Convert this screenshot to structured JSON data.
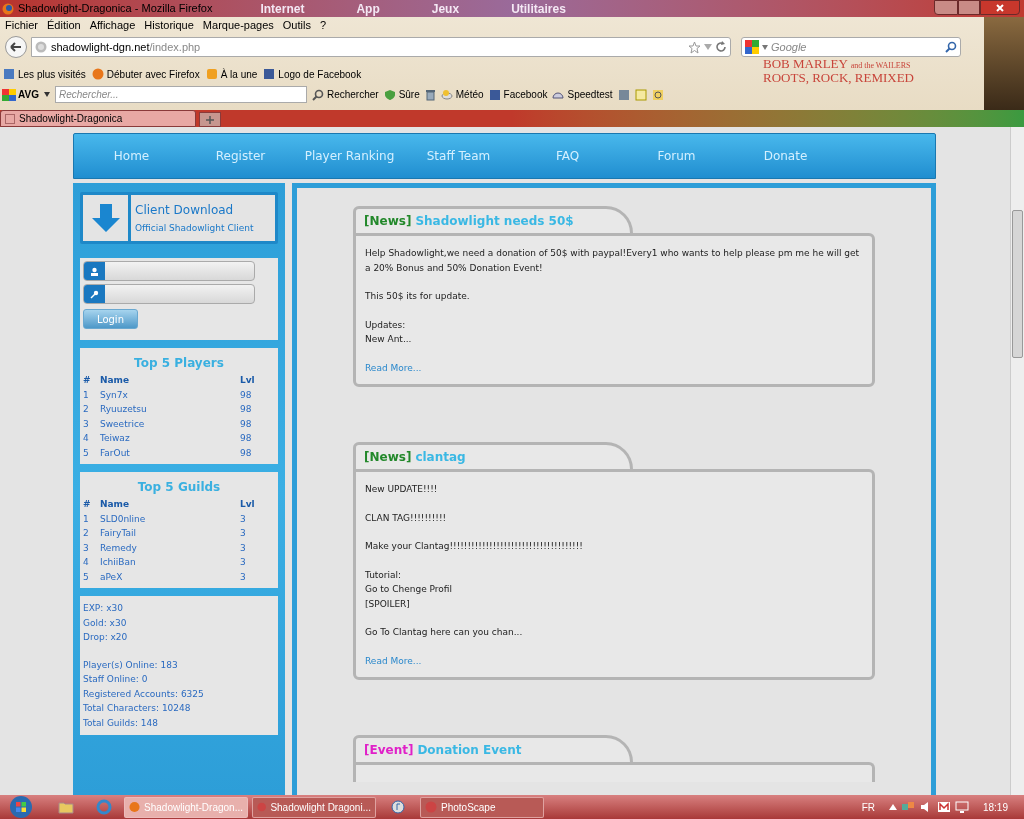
{
  "browser": {
    "window_title": "Shadowlight-Dragonica - Mozilla Firefox",
    "theme_labels": [
      "Internet",
      "App",
      "Jeux",
      "Utilitaires"
    ],
    "menu": [
      "Fichier",
      "Édition",
      "Affichage",
      "Historique",
      "Marque-pages",
      "Outils",
      "?"
    ],
    "address": {
      "domain": "shadowlight-dgn.net",
      "path": "/index.php"
    },
    "search_placeholder": "Google",
    "bookmarks": [
      "Les plus visités",
      "Débuter avec Firefox",
      "À la une",
      "Logo de Facebook"
    ],
    "avg": {
      "brand": "AVG",
      "search_placeholder": "Rechercher...",
      "items": [
        "Rechercher",
        "Sûre",
        "Météo",
        "Facebook",
        "Speedtest"
      ]
    },
    "persona": {
      "line1": "BOB MARLEY",
      "line1_small": "and the WAILERS",
      "line2": "ROOTS, ROCK, REMIXED"
    },
    "tabs": [
      {
        "label": "Shadowlight-Dragonica",
        "selected": true
      }
    ]
  },
  "nav": [
    "Home",
    "Register",
    "Player Ranking",
    "Staff Team",
    "FAQ",
    "Forum",
    "Donate"
  ],
  "sidebar": {
    "download": {
      "title": "Client Download",
      "subtitle": "Official Shadowlight Client"
    },
    "login": {
      "button": "Login"
    },
    "tables": [
      {
        "title": "Top 5 Players",
        "columns": [
          "#",
          "Name",
          "Lvl"
        ],
        "rows": [
          [
            "1",
            "Syn7x",
            "98"
          ],
          [
            "2",
            "Ryuuzetsu",
            "98"
          ],
          [
            "3",
            "Sweetrice",
            "98"
          ],
          [
            "4",
            "Teiwaz",
            "98"
          ],
          [
            "5",
            "FarOut",
            "98"
          ]
        ]
      },
      {
        "title": "Top 5 Guilds",
        "columns": [
          "#",
          "Name",
          "Lvl"
        ],
        "rows": [
          [
            "1",
            "SLD0nline",
            "3"
          ],
          [
            "2",
            "FairyTail",
            "3"
          ],
          [
            "3",
            "Remedy",
            "3"
          ],
          [
            "4",
            "IchiiBan",
            "3"
          ],
          [
            "5",
            "aPeX",
            "3"
          ]
        ]
      }
    ],
    "stats": [
      [
        "EXP: x30",
        "Gold: x30",
        "Drop: x20"
      ],
      [
        "Player(s) Online: 183",
        "Staff Online: 0",
        "Registered Accounts: 6325",
        "Total Characters: 10248",
        "Total Guilds: 148"
      ]
    ]
  },
  "posts": [
    {
      "tag": "[News]",
      "color": "#22882a",
      "title": "Shadowlight needs 50$",
      "body": [
        [
          "Help Shadowlight,we need a donation of 50$ with paypal!Every1 who wants to help please pm me he will get a 20% Bonus and 50% Donation Event!"
        ],
        [
          "This 50$ its for update."
        ],
        [
          "Updates:",
          "New Ant..."
        ]
      ],
      "read_more": "Read More..."
    },
    {
      "tag": "[News]",
      "color": "#22882a",
      "title": "clantag",
      "body": [
        [
          "New UPDATE!!!!"
        ],
        [
          "CLAN TAG!!!!!!!!!!"
        ],
        [
          "Make your Clantag!!!!!!!!!!!!!!!!!!!!!!!!!!!!!!!!!!!!!"
        ],
        [
          "Tutorial:",
          "Go to Chenge Profil",
          "[SPOILER]"
        ],
        [
          "Go To Clantag here can you chan..."
        ]
      ],
      "read_more": "Read More..."
    },
    {
      "tag": "[Event]",
      "color": "#e020c8",
      "title": "Donation Event"
    }
  ],
  "taskbar": {
    "items": [
      {
        "label": "Shadowlight-Dragon...",
        "selected": true
      },
      {
        "label": "Shadowlight Dragoni...",
        "selected": false
      },
      {
        "label": "PhotoScape",
        "selected": false
      }
    ],
    "language": "FR",
    "clock": "18:19"
  }
}
